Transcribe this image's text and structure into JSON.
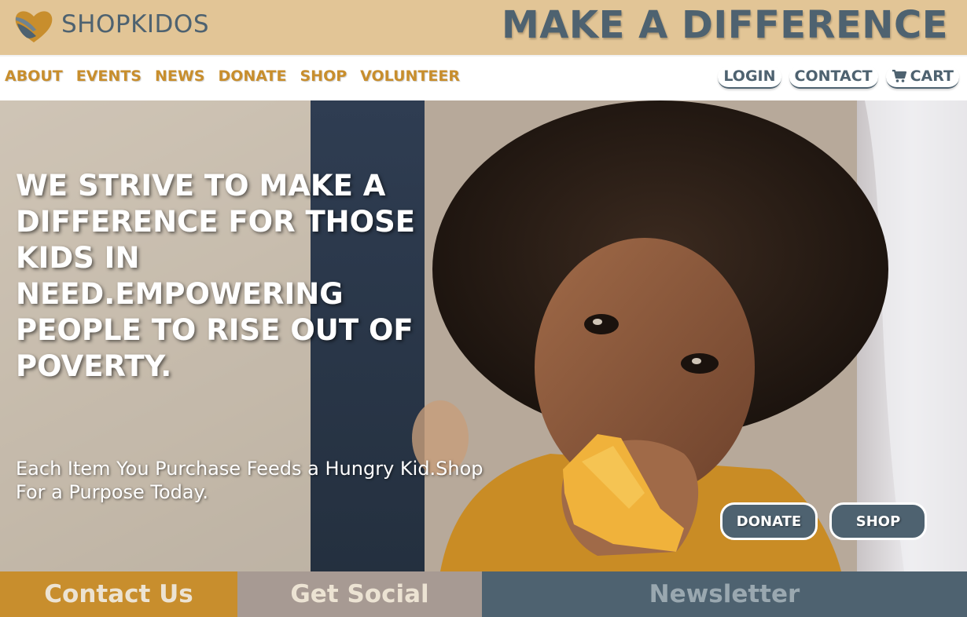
{
  "brand": {
    "name": "SHOPKIDOS",
    "tagline": "MAKE A DIFFERENCE",
    "logo_icon": "heart-hands-icon"
  },
  "nav": {
    "left": [
      "ABOUT",
      "EVENTS",
      "NEWS",
      "DONATE",
      "SHOP",
      "VOLUNTEER"
    ],
    "login": "LOGIN",
    "contact": "CONTACT",
    "cart": "CART",
    "cart_icon": "cart-icon"
  },
  "hero": {
    "heading": "WE STRIVE TO MAKE A DIFFERENCE FOR THOSE KIDS IN NEED.EMPOWERING PEOPLE TO RISE OUT OF POVERTY.",
    "subheading": "Each Item You Purchase Feeds a Hungry Kid.Shop For a Purpose Today.",
    "donate_button": "DONATE",
    "shop_button": "SHOP"
  },
  "footer": {
    "contact": "Contact Us",
    "social": "Get Social",
    "newsletter": "Newsletter"
  },
  "colors": {
    "brand_bar": "#e2c596",
    "slate": "#4e6270",
    "gold": "#c88e2d",
    "taupe": "#a79a93"
  }
}
